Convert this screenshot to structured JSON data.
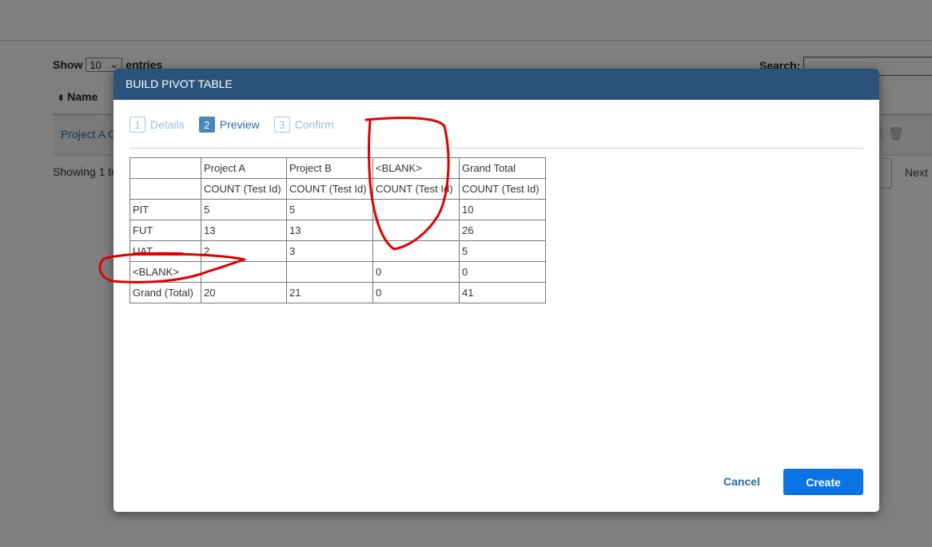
{
  "background": {
    "show_label": "Show",
    "entries_value": "10",
    "entries_label": "entries",
    "search_label": "Search:",
    "name_header": "Name",
    "row_link": "Project A C",
    "info_text": "Showing 1 to",
    "next_label": "Next"
  },
  "modal": {
    "title": "BUILD PIVOT TABLE",
    "steps": [
      {
        "num": "1",
        "label": "Details"
      },
      {
        "num": "2",
        "label": "Preview"
      },
      {
        "num": "3",
        "label": "Confirm"
      }
    ],
    "active_step": "Preview",
    "cancel_label": "Cancel",
    "create_label": "Create"
  },
  "pivot": {
    "header": [
      "",
      "Project A",
      "Project B",
      "<BLANK>",
      "Grand Total"
    ],
    "subheader": [
      "",
      "COUNT (Test Id)",
      "COUNT (Test Id)",
      "COUNT (Test Id)",
      "COUNT (Test Id)"
    ],
    "rows": [
      [
        "PIT",
        "5",
        "5",
        "",
        "10"
      ],
      [
        "FUT",
        "13",
        "13",
        "",
        "26"
      ],
      [
        "UAT",
        "2",
        "3",
        "",
        "5"
      ],
      [
        "<BLANK>",
        "",
        "",
        "0",
        "0"
      ],
      [
        "Grand (Total)",
        "20",
        "21",
        "0",
        "41"
      ]
    ]
  },
  "colors": {
    "header_bg": "#2b5279",
    "create_button": "#0b74e5",
    "link": "#2a6aa8",
    "annotation": "#e00000"
  }
}
